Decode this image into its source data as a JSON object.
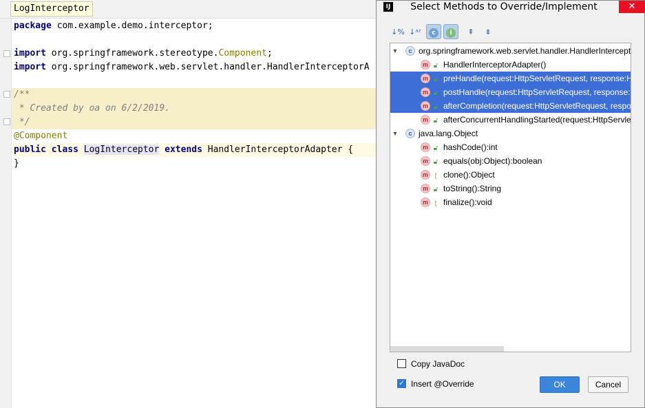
{
  "editor": {
    "tab_label": "LogInterceptor",
    "lines": [
      "package com.example.demo.interceptor;",
      "import org.springframework.stereotype.",
      "Component",
      ";",
      "import org.springframework.web.servlet.handler.HandlerInterceptorA",
      "/**",
      " * Created by oa on 6/2/2019.",
      " */",
      "@Component",
      "public class",
      "LogInterceptor",
      "extends",
      "HandlerInterceptorAdapter {",
      "}"
    ]
  },
  "dialog": {
    "title": "Select Methods to Override/Implement",
    "app_icon": "IJ",
    "close_symbol": "✕",
    "toolbar": [
      "sort-by-visibility-icon",
      "sort-alphabetically-icon",
      "show-classes-icon",
      "show-interfaces-icon",
      "expand-all-icon",
      "collapse-all-icon"
    ],
    "tree": {
      "group1": "org.springframework.web.servlet.handler.HandlerIntercept",
      "group1_items": [
        "HandlerInterceptorAdapter()",
        "preHandle(request:HttpServletRequest, response:Ht",
        "postHandle(request:HttpServletRequest, response:H",
        "afterCompletion(request:HttpServletRequest, respo",
        "afterConcurrentHandlingStarted(request:HttpServle"
      ],
      "group2": "java.lang.Object",
      "group2_items": [
        "hashCode():int",
        "equals(obj:Object):boolean",
        "clone():Object",
        "toString():String",
        "finalize():void"
      ]
    },
    "copy_javadoc": {
      "label": "Copy JavaDoc",
      "checked": false
    },
    "insert_override": {
      "label": "Insert @Override",
      "checked": true
    },
    "ok_label": "OK",
    "cancel_label": "Cancel"
  }
}
